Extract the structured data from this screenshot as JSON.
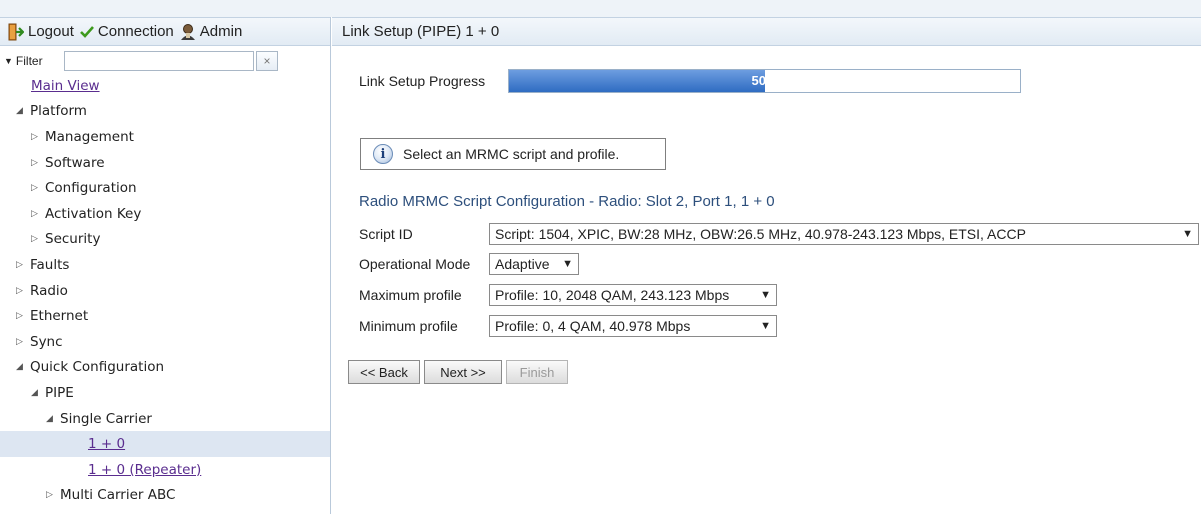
{
  "header": {
    "logout_label": "Logout",
    "connection_label": "Connection",
    "admin_label": "Admin"
  },
  "filter": {
    "label": "Filter",
    "value": "",
    "clear_glyph": "×"
  },
  "tree": {
    "main_view": "Main View",
    "platform": "Platform",
    "management": "Management",
    "software": "Software",
    "configuration": "Configuration",
    "activation_key": "Activation Key",
    "security": "Security",
    "faults": "Faults",
    "radio": "Radio",
    "ethernet": "Ethernet",
    "sync": "Sync",
    "quick_configuration": "Quick Configuration",
    "pipe": "PIPE",
    "single_carrier": "Single Carrier",
    "one_plus_zero": "1 + 0",
    "one_plus_zero_repeater": "1 + 0 (Repeater)",
    "multi_carrier_abc": "Multi Carrier ABC"
  },
  "page": {
    "title": "Link Setup (PIPE) 1 + 0",
    "progress_label": "Link Setup Progress",
    "progress_value": 0.5,
    "progress_text": "50%",
    "info_message": "Select an MRMC script and profile.",
    "section_title": "Radio MRMC Script Configuration - Radio: Slot 2, Port 1, 1 + 0",
    "script_id_label": "Script ID",
    "script_id_value": "Script: 1504, XPIC, BW:28 MHz, OBW:26.5 MHz, 40.978-243.123 Mbps, ETSI, ACCP",
    "operational_mode_label": "Operational Mode",
    "operational_mode_value": "Adaptive",
    "max_profile_label": "Maximum profile",
    "max_profile_value": "Profile: 10, 2048 QAM, 243.123 Mbps",
    "min_profile_label": "Minimum profile",
    "min_profile_value": "Profile: 0, 4 QAM, 40.978 Mbps",
    "back_label": "<< Back",
    "next_label": "Next >>",
    "finish_label": "Finish"
  },
  "colors": {
    "accent": "#2f6cc2",
    "link": "#5a2d8f",
    "section_title": "#2d4f7c"
  },
  "icons": {
    "logout": "logout-icon",
    "connection": "checkmark-icon",
    "admin": "admin-user-icon",
    "info": "info-icon"
  }
}
